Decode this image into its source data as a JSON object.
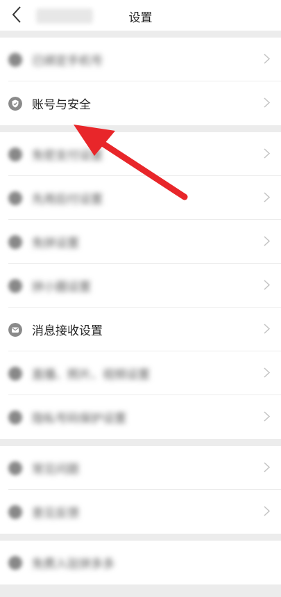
{
  "nav": {
    "title": "设置"
  },
  "groups": [
    {
      "items": [
        {
          "label": "已绑定手机号",
          "blurred": true
        },
        {
          "label": "账号与安全",
          "blurred": false
        }
      ]
    },
    {
      "items": [
        {
          "label": "免密支付设置",
          "blurred": true
        },
        {
          "label": "先用后付设置",
          "blurred": true
        },
        {
          "label": "免拼设置",
          "blurred": true
        },
        {
          "label": "拼小圈设置",
          "blurred": true
        },
        {
          "label": "消息接收设置",
          "blurred": false
        },
        {
          "label": "直播、照片、视频设置",
          "blurred": true
        },
        {
          "label": "隐私号码保护设置",
          "blurred": true
        }
      ]
    },
    {
      "items": [
        {
          "label": "常见问题",
          "blurred": true
        },
        {
          "label": "意见反馈",
          "blurred": true
        }
      ]
    },
    {
      "items": [
        {
          "label": "免费入驻拼多多",
          "blurred": true
        }
      ]
    }
  ],
  "colors": {
    "arrow": "#e8262a",
    "icon": "#8a8a8a",
    "separator": "#ececec"
  }
}
